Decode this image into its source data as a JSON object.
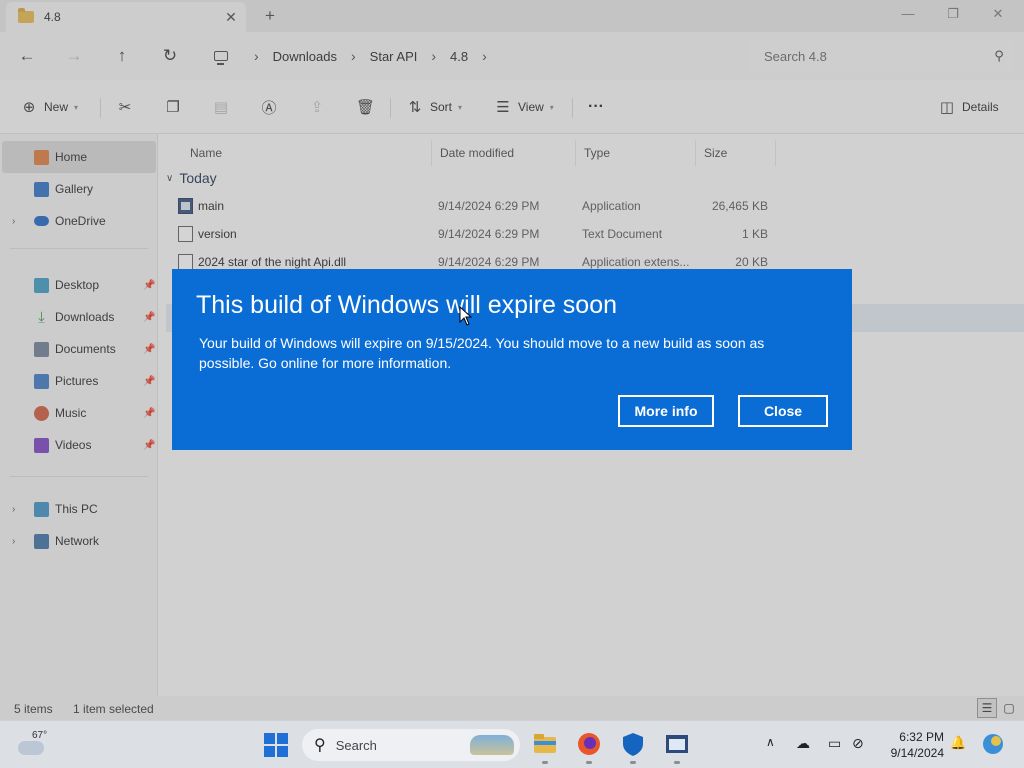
{
  "window": {
    "tab_title": "4.8",
    "tab_close": "✕",
    "new_tab": "+",
    "minimize": "—",
    "maximize": "❐",
    "close": "✕"
  },
  "nav": {
    "back": "←",
    "forward": "→",
    "up": "↑",
    "refresh": "↻",
    "breadcrumb": [
      "Downloads",
      "Star API",
      "4.8"
    ],
    "separator": "›",
    "search_placeholder": "Search 4.8"
  },
  "commands": {
    "new_label": "New",
    "sort_label": "Sort",
    "view_label": "View",
    "more": "···",
    "details_label": "Details"
  },
  "sidebar": {
    "items": [
      {
        "label": "Home",
        "icon": "home-icon",
        "color": "#e07a3a",
        "selected": true
      },
      {
        "label": "Gallery",
        "icon": "gallery-icon",
        "color": "#2b6fc4"
      },
      {
        "label": "OneDrive",
        "icon": "onedrive-icon",
        "color": "#1d63c7",
        "expandable": true
      },
      {
        "label": "Desktop",
        "icon": "desktop-icon",
        "color": "#3a9bc4",
        "pinned": true
      },
      {
        "label": "Downloads",
        "icon": "downloads-icon",
        "color": "#2b9a4a",
        "pinned": true
      },
      {
        "label": "Documents",
        "icon": "documents-icon",
        "color": "#6d7f96",
        "pinned": true
      },
      {
        "label": "Pictures",
        "icon": "pictures-icon",
        "color": "#3a78c4",
        "pinned": true
      },
      {
        "label": "Music",
        "icon": "music-icon",
        "color": "#d0573a",
        "pinned": true
      },
      {
        "label": "Videos",
        "icon": "videos-icon",
        "color": "#7a3fc4",
        "pinned": true
      },
      {
        "label": "This PC",
        "icon": "this-pc-icon",
        "color": "#3a8fc4",
        "expandable": true
      },
      {
        "label": "Network",
        "icon": "network-icon",
        "color": "#3a6fa4",
        "expandable": true
      }
    ]
  },
  "files": {
    "columns": [
      "Name",
      "Date modified",
      "Type",
      "Size"
    ],
    "group": "Today",
    "rows": [
      {
        "name": "main",
        "date": "9/14/2024 6:29 PM",
        "type": "Application",
        "size": "26,465 KB",
        "kind": "app"
      },
      {
        "name": "version",
        "date": "9/14/2024 6:29 PM",
        "type": "Text Document",
        "size": "1 KB",
        "kind": "text"
      },
      {
        "name": "2024 star of the night Api.dll",
        "date": "9/14/2024 6:29 PM",
        "type": "Application extens...",
        "size": "20 KB",
        "kind": "dll"
      }
    ]
  },
  "status": {
    "items": "5 items",
    "selected": "1 item selected"
  },
  "dialog": {
    "title": "This build of Windows will expire soon",
    "body": "Your build of Windows will expire on 9/15/2024. You should move to a new build as soon as possible. Go online for more information.",
    "more_info": "More info",
    "close": "Close",
    "color": "#0a6dd6"
  },
  "taskbar": {
    "temperature": "67°",
    "search_label": "Search",
    "time": "6:32 PM",
    "date": "9/14/2024",
    "start_color": "#1f6fd6"
  }
}
